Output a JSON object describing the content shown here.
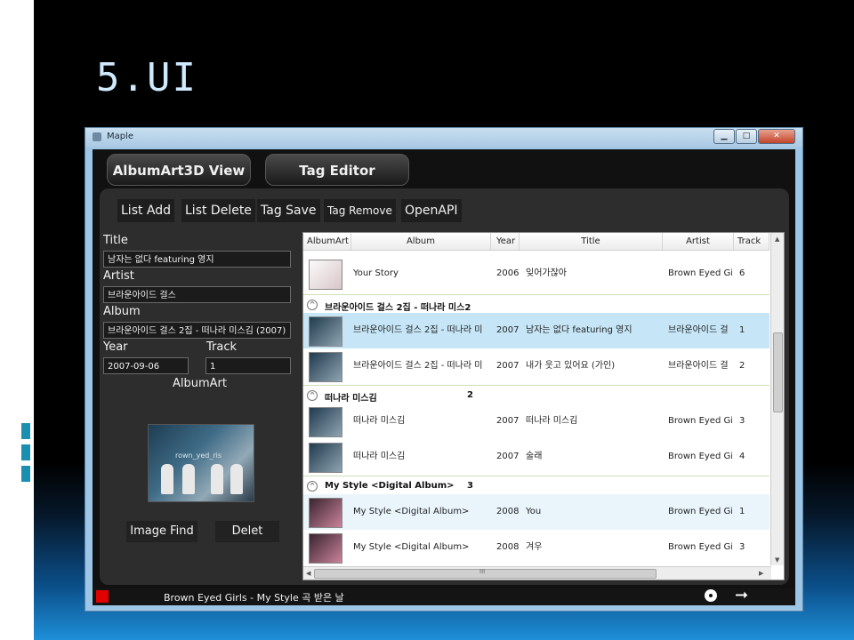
{
  "slide": {
    "title": "5.UI"
  },
  "window": {
    "title": "Maple",
    "minimize": "▁",
    "maximize": "□",
    "close": "✕"
  },
  "tabs": {
    "albumart3d": "AlbumArt3D View",
    "tag_editor": "Tag Editor"
  },
  "toolbar": {
    "list_add": "List Add",
    "list_delete": "List Delete",
    "tag_save": "Tag Save",
    "tag_remove": "Tag Remove",
    "openapi": "OpenAPI"
  },
  "editor": {
    "title_label": "Title",
    "title_value": "남자는 없다 featuring 영지",
    "artist_label": "Artist",
    "artist_value": "브라운아이드 걸스",
    "album_label": "Album",
    "album_value": "브라운아이드 걸스 2집 - 떠나라 미스김 (2007)",
    "year_label": "Year",
    "year_value": "2007-09-06",
    "track_label": "Track",
    "track_value": "1",
    "albumart_label": "AlbumArt",
    "image_find": "Image Find",
    "delete": "Delet"
  },
  "grid": {
    "columns": [
      "AlbumArt",
      "Album",
      "Year",
      "Title",
      "Artist",
      "Track"
    ],
    "top_row": {
      "album": "Your Story",
      "year": "2006",
      "title": "잊어가잖아",
      "artist": "Brown Eyed Girl",
      "track": "6"
    },
    "groups": [
      {
        "name": "브라운아이드 걸스 2집 - 떠나라 미스2",
        "count": "",
        "rows": [
          {
            "album": "브라운아이드 걸스 2집 - 떠나라 미",
            "year": "2007",
            "title": "남자는 없다 featuring 영지",
            "artist": "브라운아이드 걸",
            "track": "1"
          },
          {
            "album": "브라운아이드 걸스 2집 - 떠나라 미",
            "year": "2007",
            "title": "내가 웃고 있어요 (가인)",
            "artist": "브라운아이드 걸",
            "track": "2"
          }
        ]
      },
      {
        "name": "떠나라 미스김",
        "count": "2",
        "rows": [
          {
            "album": "떠나라 미스김",
            "year": "2007",
            "title": "떠나라 미스김",
            "artist": "Brown Eyed Girl",
            "track": "3"
          },
          {
            "album": "떠나라 미스김",
            "year": "2007",
            "title": "술래",
            "artist": "Brown Eyed Girl",
            "track": "4"
          }
        ]
      },
      {
        "name": "My Style <Digital Album>",
        "count": "3",
        "rows": [
          {
            "album": "My Style <Digital Album>",
            "year": "2008",
            "title": "You",
            "artist": "Brown Eyed Girl",
            "track": "1"
          },
          {
            "album": "My Style <Digital Album>",
            "year": "2008",
            "title": "겨우",
            "artist": "Brown Eyed Girl",
            "track": "3"
          }
        ]
      }
    ],
    "hscroll_grip": "III"
  },
  "albumart_caption": "rown_yed_ris",
  "status": {
    "now_playing": "Brown Eyed Girls - My Style 곡 받은 날",
    "next": "➞"
  }
}
